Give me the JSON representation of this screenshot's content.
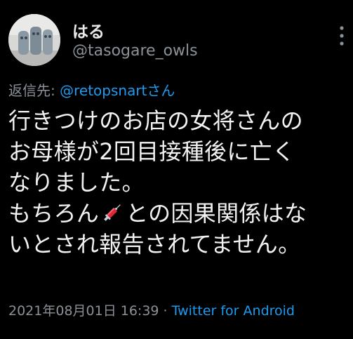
{
  "tweet": {
    "display_name": "はる",
    "handle": "@tasogare_owls",
    "reply_prefix": "返信先: ",
    "reply_target": "@retopsnartさん",
    "body_lines": {
      "l1": "行きつけのお店の女将さんの",
      "l2": "お母様が2回目接種後に亡く",
      "l3": "なりました。",
      "l4_before": "もちろん",
      "l4_after": "との因果関係はな",
      "l5": "いとされ報告されてません。"
    },
    "timestamp": "2021年08月01日 16:39",
    "separator": " · ",
    "source_app": "Twitter for Android"
  },
  "icons": {
    "avatar": "owl-figurines-avatar",
    "more": "more-vertical-icon",
    "inline": "syringe-emoji"
  },
  "colors": {
    "background": "#000000",
    "text_primary": "#e7e9ea",
    "text_secondary": "#8b9198",
    "link": "#1d9bf0",
    "syringe_red": "#e0263a"
  }
}
